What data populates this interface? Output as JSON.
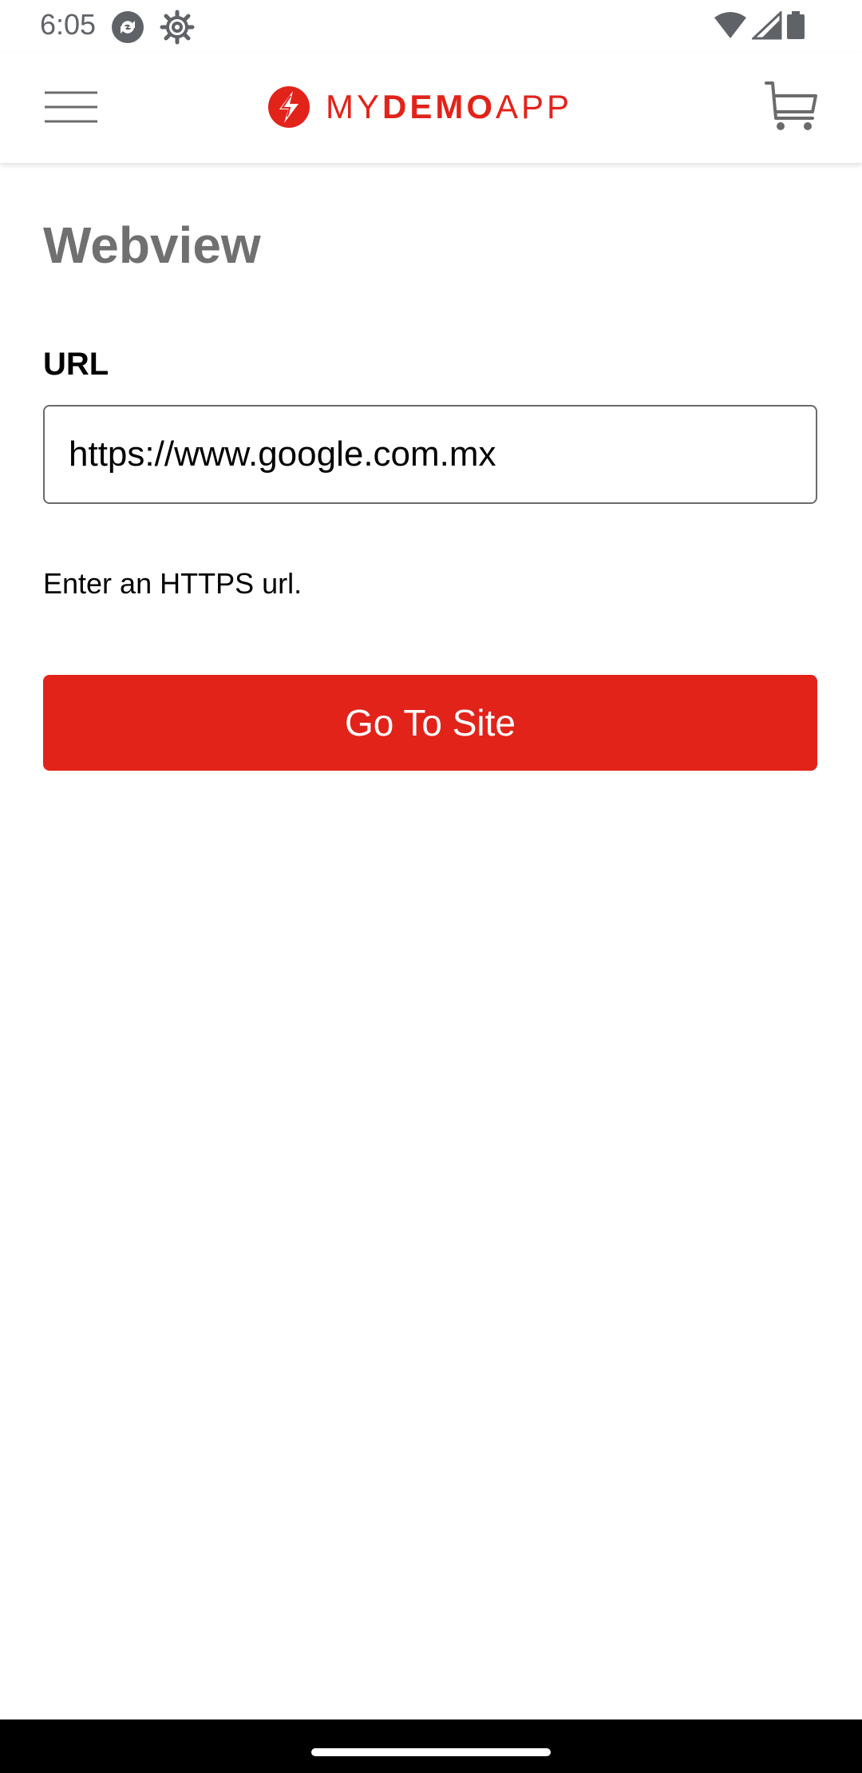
{
  "status_bar": {
    "time": "6:05",
    "icons": [
      "sync-icon",
      "settings-gear-icon",
      "wifi-icon",
      "signal-icon",
      "battery-icon"
    ]
  },
  "app_bar": {
    "brand_light_1": "MY",
    "brand_strong": "DEMO",
    "brand_light_2": "APP",
    "menu_icon": "hamburger-menu-icon",
    "cart_icon": "cart-icon"
  },
  "page": {
    "title": "Webview",
    "url_label": "URL",
    "url_value": "https://www.google.com.mx",
    "hint": "Enter an HTTPS url.",
    "go_button_label": "Go To Site"
  },
  "colors": {
    "accent": "#e2231a",
    "title_gray": "#707070",
    "text": "#000000"
  }
}
